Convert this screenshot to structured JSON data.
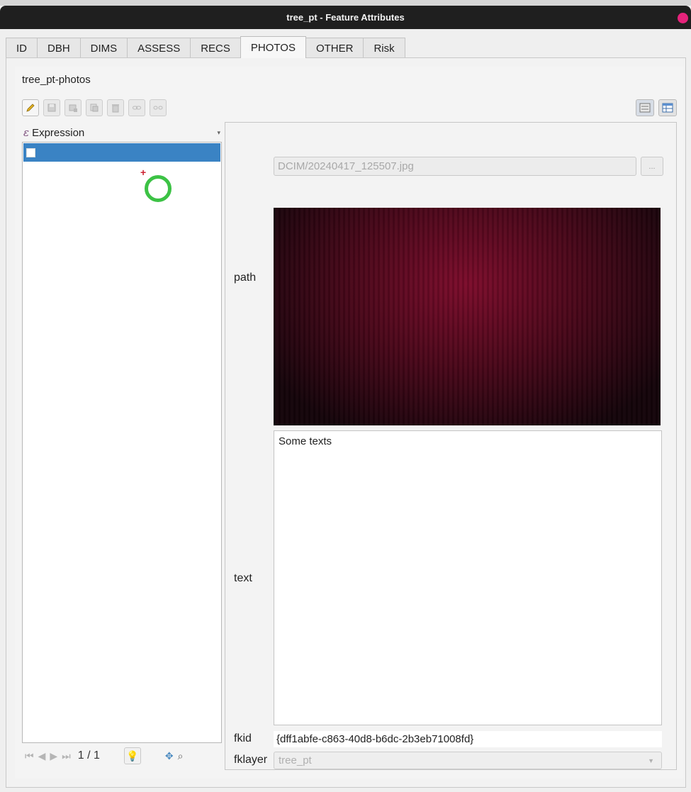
{
  "window": {
    "title": "tree_pt - Feature Attributes"
  },
  "tabs": [
    {
      "label": "ID"
    },
    {
      "label": "DBH"
    },
    {
      "label": "DIMS"
    },
    {
      "label": "ASSESS"
    },
    {
      "label": "RECS"
    },
    {
      "label": "PHOTOS",
      "active": true
    },
    {
      "label": "OTHER"
    },
    {
      "label": "Risk"
    }
  ],
  "form": {
    "title": "tree_pt-photos",
    "expression_header": "Expression",
    "expression_icon": "ε"
  },
  "navigation": {
    "count": "1 / 1"
  },
  "fields": {
    "path_label": "path",
    "path_value": "DCIM/20240417_125507.jpg",
    "browse_label": "...",
    "text_label": "text",
    "text_value": "Some texts",
    "fkid_label": "fkid",
    "fkid_value": "{dff1abfe-c863-40d8-b6dc-2b3eb71008fd}",
    "fklayer_label": "fklayer",
    "fklayer_value": "tree_pt"
  },
  "colors": {
    "selected_row": "#3a83c4",
    "titlebar": "#1f1f1f",
    "close_dot": "#e5237b",
    "cursor_ring": "#3cc245"
  }
}
